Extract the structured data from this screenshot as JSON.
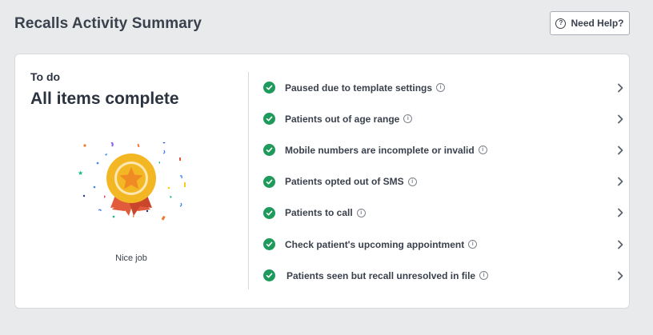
{
  "header": {
    "title": "Recalls Activity Summary",
    "help_label": "Need Help?",
    "help_icon": "question-circle-icon"
  },
  "card": {
    "todo_label": "To do",
    "status_title": "All items complete",
    "illustration": "award-medal-confetti",
    "caption": "Nice job"
  },
  "items": [
    {
      "label": "Paused due to template settings",
      "icon": "check-circle-icon"
    },
    {
      "label": "Patients out of age range",
      "icon": "check-circle-icon"
    },
    {
      "label": "Mobile numbers are incomplete or invalid",
      "icon": "check-circle-icon"
    },
    {
      "label": "Patients opted out of SMS",
      "icon": "check-circle-icon"
    },
    {
      "label": "Patients to call",
      "icon": "check-circle-icon"
    },
    {
      "label": "Check patient's upcoming appointment",
      "icon": "check-circle-icon"
    },
    {
      "label": "Patients seen but recall unresolved in file",
      "icon": "check-circle-icon"
    }
  ],
  "colors": {
    "background": "#e9eaec",
    "check_green": "#1e9a5c",
    "medal_gold": "#f4b724",
    "ribbon_red": "#e15a3c"
  }
}
